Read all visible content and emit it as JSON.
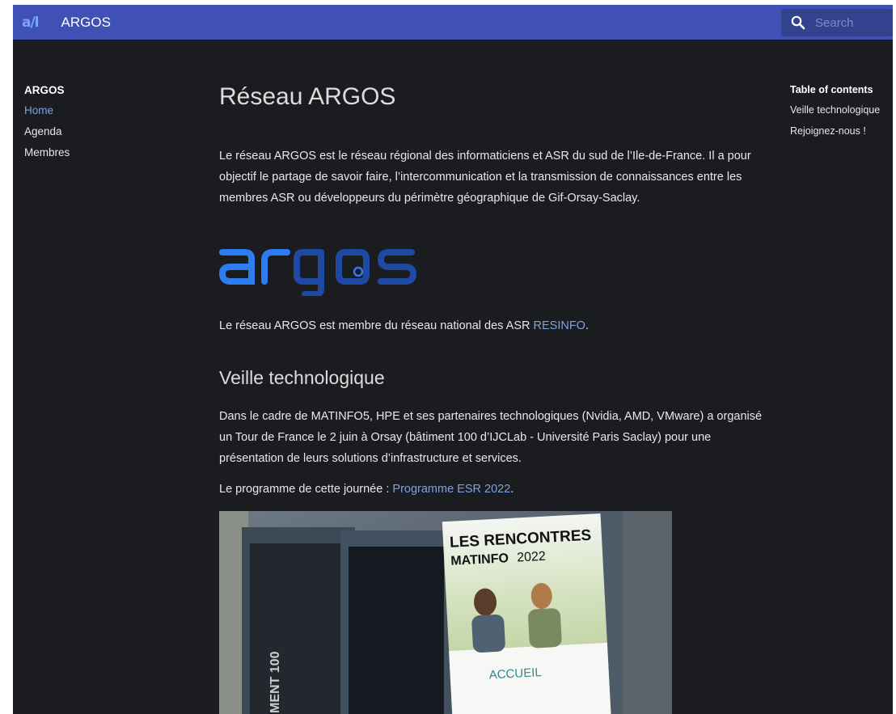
{
  "header": {
    "logo_text": "a/l",
    "site_title": "ARGOS",
    "search_placeholder": "Search"
  },
  "left_nav": {
    "title": "ARGOS",
    "items": [
      {
        "label": "Home",
        "active": true
      },
      {
        "label": "Agenda",
        "active": false
      },
      {
        "label": "Membres",
        "active": false
      }
    ]
  },
  "toc": {
    "title": "Table of contents",
    "items": [
      {
        "label": "Veille technologique"
      },
      {
        "label": "Rejoignez-nous !"
      }
    ]
  },
  "main": {
    "title": "Réseau ARGOS",
    "intro": "Le réseau ARGOS est le réseau régional des informaticiens et ASR du sud de l’Ile-de-France. Il a pour objectif le partage de savoir faire, l’intercommunication et la transmission de connaissances entre les membres ASR ou développeurs du périmètre géographique de Gif-Orsay-Saclay.",
    "logo_wordmark": "argos",
    "member_text": "Le réseau ARGOS est membre du réseau national des ASR ",
    "member_link": "RESINFO",
    "member_suffix": ".",
    "section_title": "Veille technologique",
    "veille_text": "Dans le cadre de MATINFO5, HPE et ses partenaires technologiques (Nvidia, AMD, VMware) a organisé un Tour de France le 2 juin à Orsay (bâtiment 100 d’IJCLab - Université Paris Saclay) pour une présentation de leurs solutions d’infrastructure et services.",
    "programme_text": "Le programme de cette journée : ",
    "programme_link": "Programme ESR 2022",
    "programme_suffix": ".",
    "photo": {
      "poster_line1": "LES RENCONTRES",
      "poster_line2": "MATINFO",
      "poster_year": "2022",
      "poster_accueil": "ACCUEIL",
      "building_text": "MENT 100"
    }
  },
  "colors": {
    "header_bg": "#3f51b5",
    "page_bg": "#1b1c20",
    "link": "#7ea2df",
    "logo_light": "#2e7cf2",
    "logo_dark": "#1f4aa3"
  }
}
